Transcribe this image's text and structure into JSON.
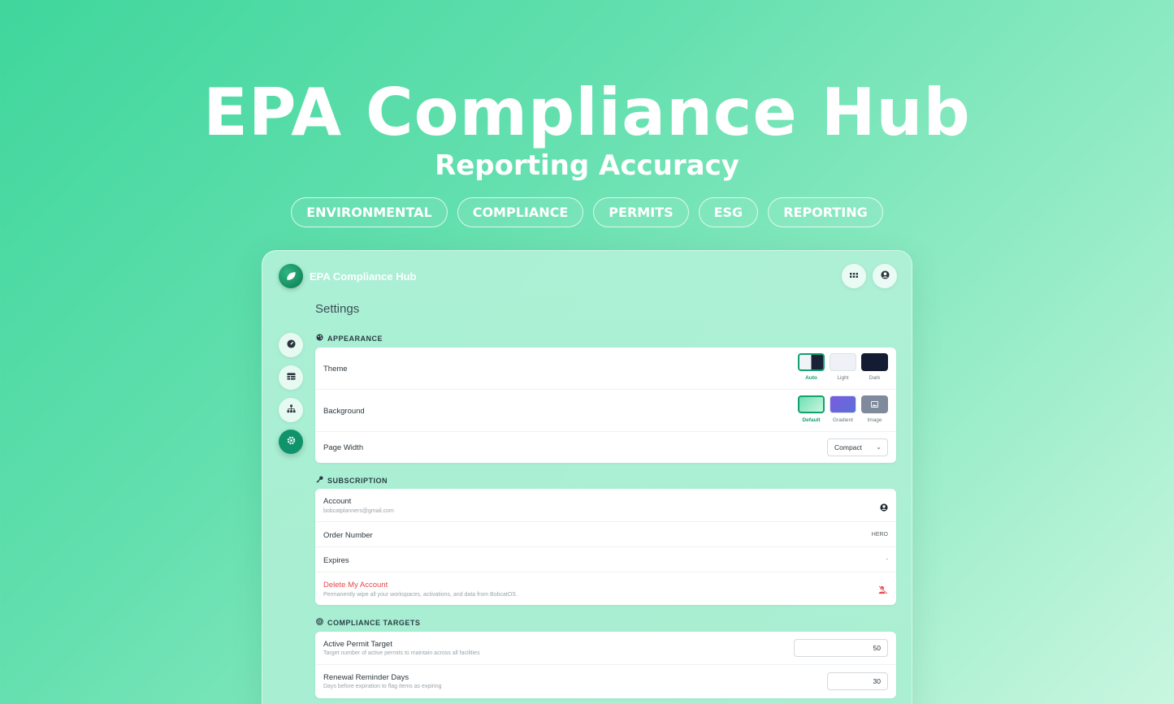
{
  "hero": {
    "title": "EPA Compliance Hub",
    "subtitle": "Reporting Accuracy",
    "tags": [
      "ENVIRONMENTAL",
      "COMPLIANCE",
      "PERMITS",
      "ESG",
      "REPORTING"
    ]
  },
  "app": {
    "name": "EPA Compliance Hub",
    "logo_icon": "leaf-icon",
    "top_buttons": [
      "apps-grid-icon",
      "user-circle-icon"
    ],
    "page_title": "Settings",
    "sidebar": [
      {
        "icon": "dashboard-gauge-icon",
        "active": false
      },
      {
        "icon": "table-icon",
        "active": false
      },
      {
        "icon": "org-chart-icon",
        "active": false
      },
      {
        "icon": "gear-icon",
        "active": true
      }
    ]
  },
  "appearance": {
    "label": "APPEARANCE",
    "theme": {
      "label": "Theme",
      "options": [
        "Auto",
        "Light",
        "Dark"
      ],
      "selected": "Auto"
    },
    "background": {
      "label": "Background",
      "options": [
        "Default",
        "Gradient",
        "Image"
      ],
      "selected": "Default"
    },
    "page_width": {
      "label": "Page Width",
      "value": "Compact"
    }
  },
  "subscription": {
    "label": "SUBSCRIPTION",
    "account_label": "Account",
    "account_email": "bobcatplanners@gmail.com",
    "order_label": "Order Number",
    "order_value": "HERO",
    "expires_label": "Expires",
    "expires_value": "-",
    "delete_label": "Delete My Account",
    "delete_desc": "Permanently wipe all your workspaces, activations, and data from BobcatOS."
  },
  "compliance_targets": {
    "label": "COMPLIANCE TARGETS",
    "active_permit_label": "Active Permit Target",
    "active_permit_desc": "Target number of active permits to maintain across all facilities",
    "active_permit_value": "50",
    "renewal_label": "Renewal Reminder Days",
    "renewal_desc": "Days before expiration to flag items as expiring",
    "renewal_value": "30"
  },
  "colors": {
    "accent": "#14a06f",
    "danger": "#e5484d"
  }
}
